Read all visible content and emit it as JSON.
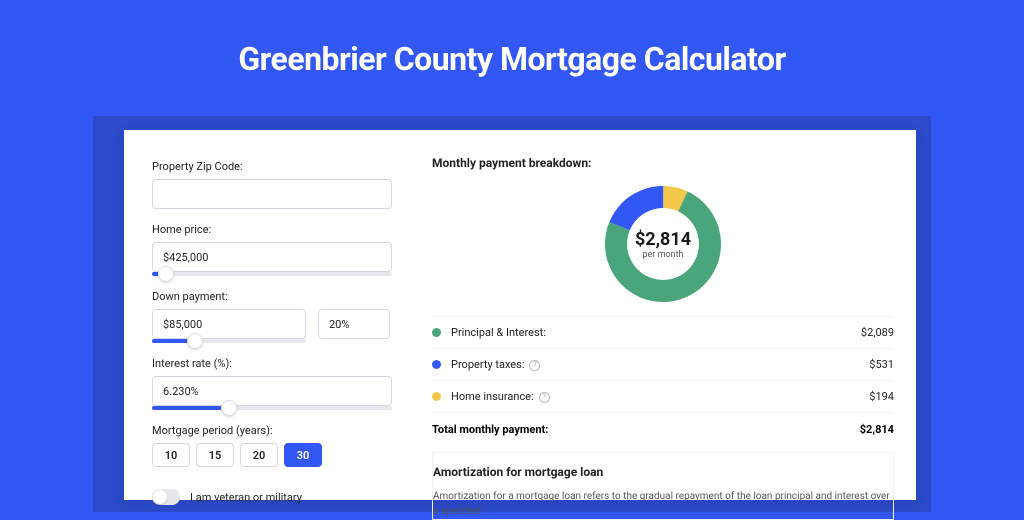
{
  "ui": {
    "page_title": "Greenbrier County Mortgage Calculator",
    "zip_label": "Property Zip Code:",
    "zip_value": "",
    "home_price_label": "Home price:",
    "home_price_value": "$425,000",
    "home_price_slider_pct": 6,
    "down_payment_label": "Down payment:",
    "down_payment_value": "$85,000",
    "down_payment_pct": "20%",
    "down_payment_slider_pct": 28,
    "interest_label": "Interest rate (%):",
    "interest_value": "6.230%",
    "interest_slider_pct": 32,
    "period_label": "Mortgage period (years):",
    "periods": [
      "10",
      "15",
      "20",
      "30"
    ],
    "selected_period": "30",
    "veteran_label": "I am veteran or military",
    "breakdown_title": "Monthly payment breakdown:",
    "total_value": "$2,814",
    "per_month": "per month",
    "legend": {
      "pi_label": "Principal & Interest:",
      "pi_value": "$2,089",
      "tax_label": "Property taxes:",
      "tax_value": "$531",
      "ins_label": "Home insurance:",
      "ins_value": "$194",
      "total_label": "Total monthly payment:",
      "total_value": "$2,814"
    },
    "amort_title": "Amortization for mortgage loan",
    "amort_body": "Amortization for a mortgage loan refers to the gradual repayment of the loan principal and interest over a specified"
  },
  "colors": {
    "pi": "#4aa57a",
    "tax": "#3257f5",
    "ins": "#f3c84a"
  },
  "chart_data": {
    "type": "pie",
    "title": "Monthly payment breakdown",
    "categories": [
      "Principal & Interest",
      "Property taxes",
      "Home insurance"
    ],
    "values": [
      2089,
      531,
      194
    ],
    "colors": [
      "#4aa57a",
      "#3257f5",
      "#f3c84a"
    ],
    "center_label": "$2,814",
    "center_sublabel": "per month",
    "inner_radius_frac": 0.62
  }
}
